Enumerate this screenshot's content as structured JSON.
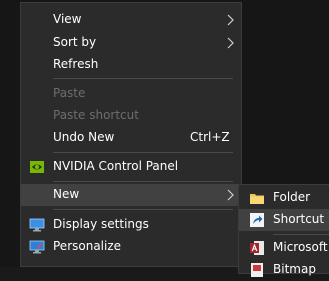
{
  "context_menu": {
    "items": [
      {
        "label": "View",
        "has_submenu": true
      },
      {
        "label": "Sort by",
        "has_submenu": true
      },
      {
        "label": "Refresh"
      },
      {
        "label": "Paste",
        "disabled": true
      },
      {
        "label": "Paste shortcut",
        "disabled": true
      },
      {
        "label": "Undo New",
        "shortcut": "Ctrl+Z"
      },
      {
        "label": "NVIDIA Control Panel",
        "icon": "nvidia-icon"
      },
      {
        "label": "New",
        "has_submenu": true,
        "highlighted": true
      },
      {
        "label": "Display settings",
        "icon": "display-settings-icon"
      },
      {
        "label": "Personalize",
        "icon": "personalize-icon"
      }
    ]
  },
  "new_submenu": {
    "items": [
      {
        "label": "Folder",
        "icon": "folder-icon"
      },
      {
        "label": "Shortcut",
        "icon": "shortcut-icon",
        "highlighted": true
      },
      {
        "label": "Microsoft A",
        "icon": "access-icon"
      },
      {
        "label": "Bitmap",
        "icon": "bitmap-icon"
      }
    ]
  },
  "colors": {
    "menu_bg": "#2b2b2b",
    "hover_bg": "#414141",
    "disabled_text": "#6d6d6d",
    "separator": "#4a4a4a"
  }
}
